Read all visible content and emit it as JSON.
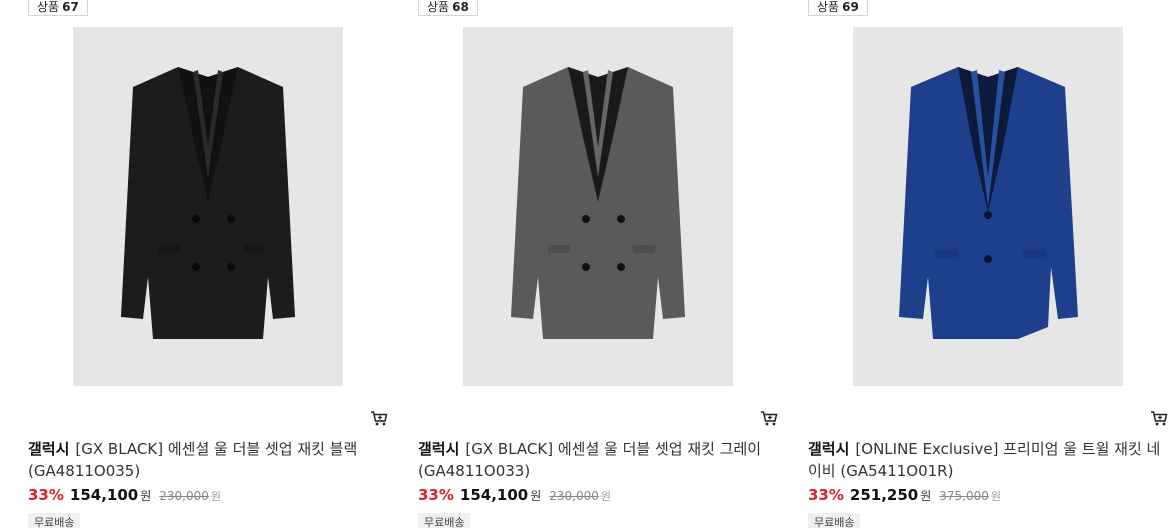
{
  "products": [
    {
      "rank_label": "상품",
      "rank_number": "67",
      "brand": "갤럭시",
      "name": "[GX BLACK] 에센셜 울 더블 셋업 재킷 블랙 (GA4811O035)",
      "discount": "33%",
      "price": "154,100",
      "currency": "원",
      "original_price": "230,000",
      "original_currency": "원",
      "shipping": "무료배송",
      "image_color": "#1c1c1c",
      "image_desc": "black double-breasted jacket"
    },
    {
      "rank_label": "상품",
      "rank_number": "68",
      "brand": "갤럭시",
      "name": "[GX BLACK] 에센셜 울 더블 셋업 재킷 그레이 (GA4811O033)",
      "discount": "33%",
      "price": "154,100",
      "currency": "원",
      "original_price": "230,000",
      "original_currency": "원",
      "shipping": "무료배송",
      "image_color": "#585858",
      "image_desc": "grey double-breasted jacket"
    },
    {
      "rank_label": "상품",
      "rank_number": "69",
      "brand": "갤럭시",
      "name": "[ONLINE Exclusive] 프리미엄 울 트윌 재킷 네이비 (GA5411O01R)",
      "discount": "33%",
      "price": "251,250",
      "currency": "원",
      "original_price": "375,000",
      "original_currency": "원",
      "shipping": "무료배송",
      "image_color": "#1d3f8c",
      "image_desc": "navy single-breasted jacket"
    }
  ],
  "icons": {
    "cart": "cart-icon"
  },
  "colors": {
    "discount": "#e0202a",
    "thumb_bg": "#e6e6e6"
  }
}
